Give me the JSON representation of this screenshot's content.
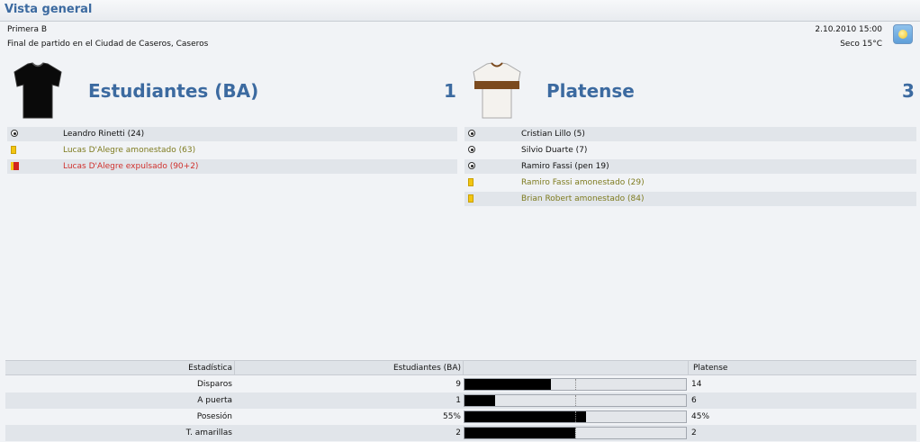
{
  "window": {
    "title": "Vista general"
  },
  "match": {
    "competition": "Primera B",
    "venue": "Final de partido en el Ciudad de Caseros, Caseros",
    "datetime": "2.10.2010 15:00",
    "weather": "Seco 15°C",
    "weather_icon": "sunny-weather-icon"
  },
  "home": {
    "name": "Estudiantes (BA)",
    "score": "1",
    "shirt_color": "#0a0a0a",
    "events": [
      {
        "type": "goal",
        "icon": "ball-icon",
        "text": "Leandro Rinetti (24)"
      },
      {
        "type": "yellow",
        "icon": "yellow-card-icon",
        "text": "Lucas D'Alegre amonestado (63)"
      },
      {
        "type": "red",
        "icon": "red-card-icon",
        "text": "Lucas D'Alegre expulsado (90+2)"
      }
    ]
  },
  "away": {
    "name": "Platense",
    "score": "3",
    "shirt_color": "#f4f2ee",
    "stripe_color": "#7b4a1e",
    "events": [
      {
        "type": "goal",
        "icon": "ball-icon",
        "text": "Cristian Lillo (5)"
      },
      {
        "type": "goal",
        "icon": "ball-icon",
        "text": "Silvio Duarte (7)"
      },
      {
        "type": "goal",
        "icon": "ball-icon",
        "text": "Ramiro Fassi (pen 19)"
      },
      {
        "type": "yellow",
        "icon": "yellow-card-icon",
        "text": "Ramiro Fassi amonestado (29)"
      },
      {
        "type": "yellow",
        "icon": "yellow-card-icon",
        "text": "Brian Robert amonestado (84)"
      }
    ]
  },
  "stats": {
    "header": {
      "stat": "Estadística",
      "home": "Estudiantes (BA)",
      "away": "Platense"
    },
    "rows": [
      {
        "label": "Disparos",
        "home": "9",
        "away": "14",
        "home_share": 0.39
      },
      {
        "label": "A puerta",
        "home": "1",
        "away": "6",
        "home_share": 0.14
      },
      {
        "label": "Posesión",
        "home": "55%",
        "away": "45%",
        "home_share": 0.55
      },
      {
        "label": "T. amarillas",
        "home": "2",
        "away": "2",
        "home_share": 0.5
      }
    ]
  },
  "colors": {
    "accent": "#3c6aa0",
    "yellow_text": "#7e7b1f",
    "red_text": "#d0312d"
  }
}
